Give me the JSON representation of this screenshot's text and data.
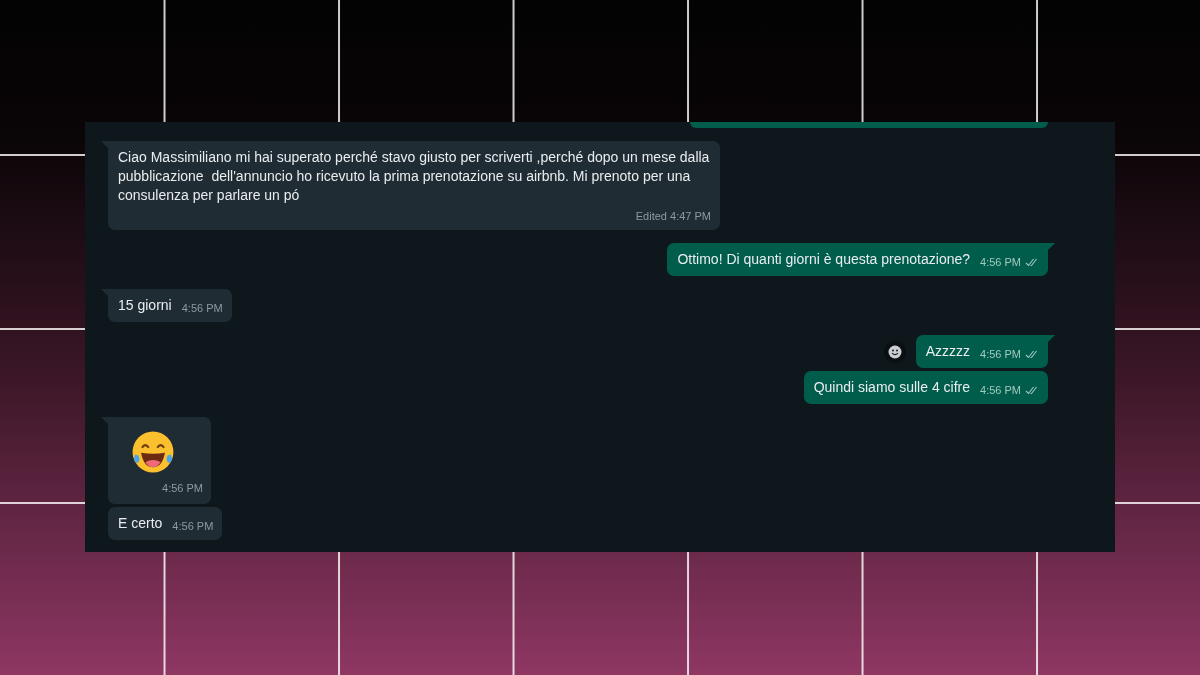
{
  "chat": {
    "messages": [
      {
        "outgoing": true,
        "kind": "clipped"
      },
      {
        "outgoing": false,
        "kind": "text",
        "text": "Ciao Massimiliano mi hai superato perché stavo giusto per scriverti ,perché dopo un mese dalla pubblicazione  dell'annuncio ho ricevuto la prima prenotazione su airbnb. Mi prenoto per una consulenza per parlare un pó",
        "time": "Edited 4:47 PM"
      },
      {
        "outgoing": true,
        "kind": "text",
        "text": "Ottimo! Di quanti giorni è questa prenotazione?",
        "time": "4:56 PM",
        "read": true
      },
      {
        "outgoing": false,
        "kind": "text",
        "text": "15 giorni",
        "time": "4:56 PM"
      },
      {
        "outgoing": true,
        "kind": "text",
        "text": "Azzzzz",
        "time": "4:56 PM",
        "read": true,
        "reaction_button": true
      },
      {
        "outgoing": true,
        "kind": "text",
        "text": "Quindi siamo sulle 4 cifre",
        "time": "4:56 PM",
        "read": true
      },
      {
        "outgoing": false,
        "kind": "emoji",
        "time": "4:56 PM"
      },
      {
        "outgoing": false,
        "kind": "text",
        "text": "E certo",
        "time": "4:56 PM"
      }
    ]
  }
}
